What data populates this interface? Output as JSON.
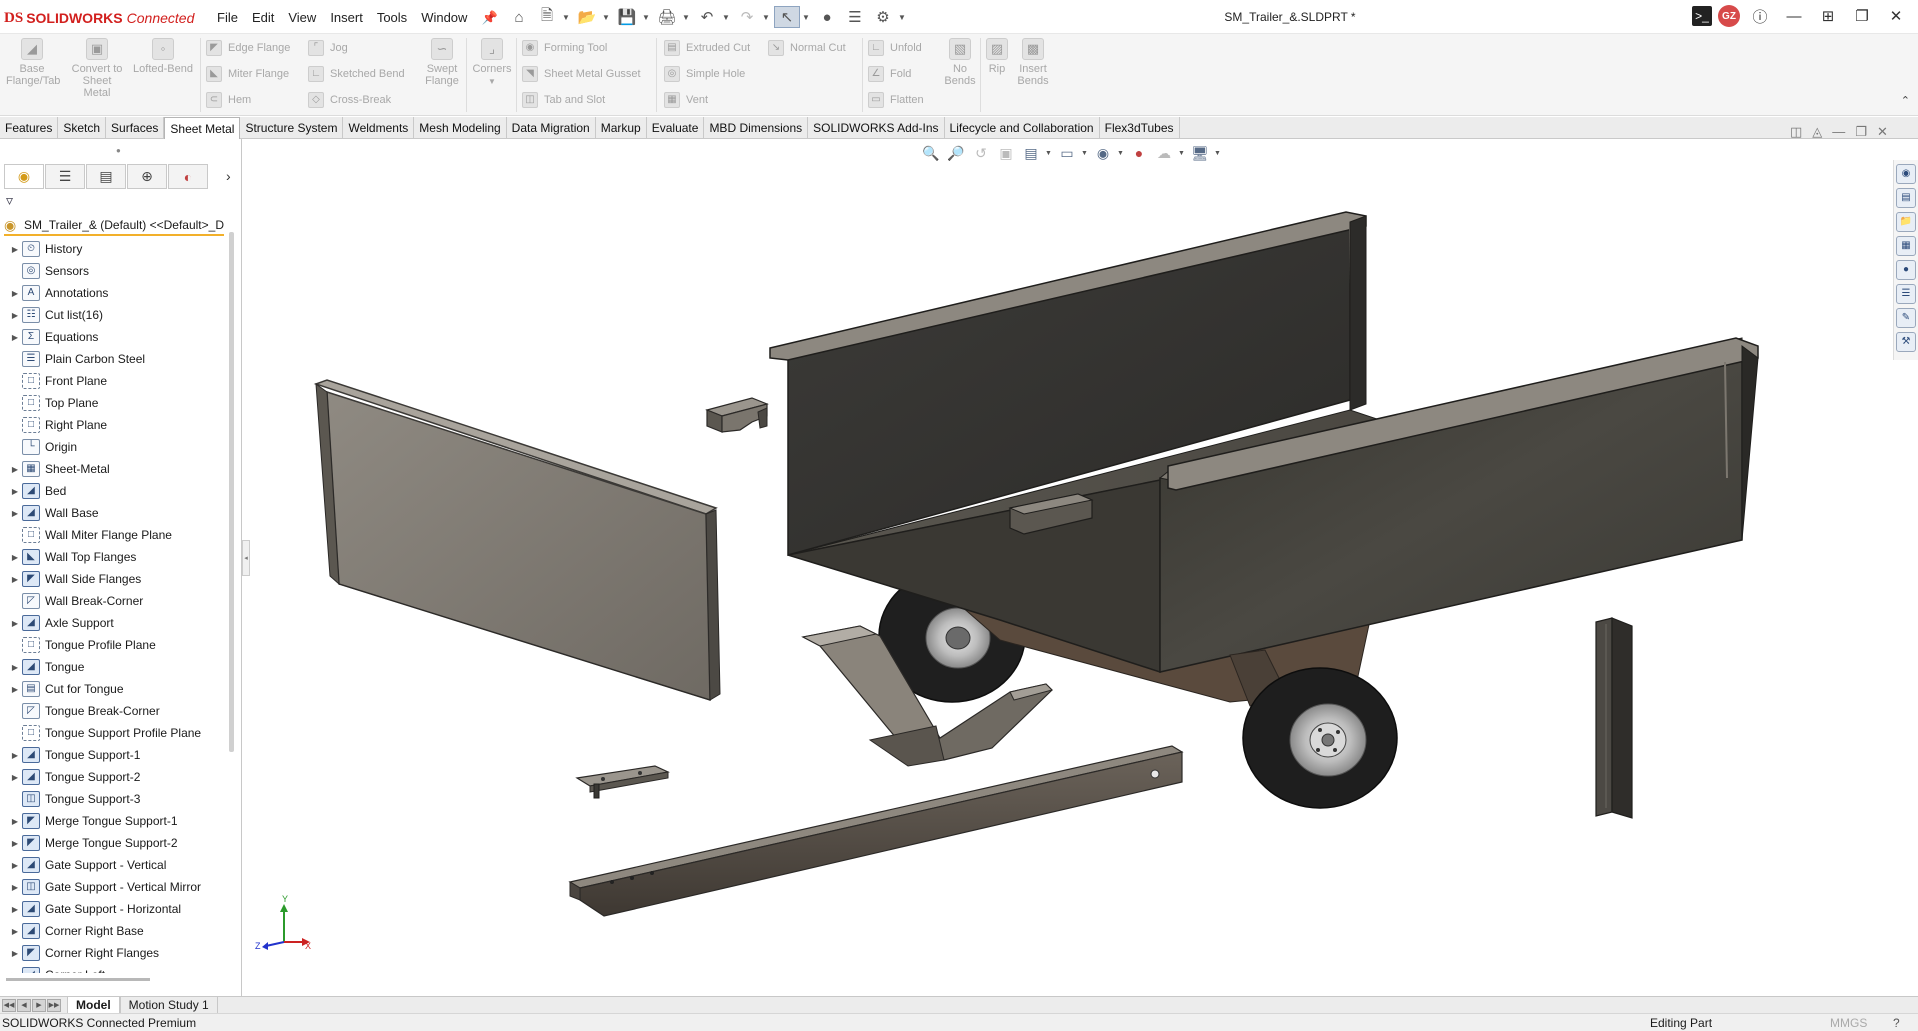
{
  "app": {
    "brand_mark": "DS",
    "brand_name": "SOLIDWORKS",
    "brand_suffix": "Connected"
  },
  "menu": [
    "File",
    "Edit",
    "View",
    "Insert",
    "Tools",
    "Window"
  ],
  "document_title": "SM_Trailer_&.SLDPRT *",
  "user_initials": "GZ",
  "ribbon": {
    "base_flange": "Base Flange/Tab",
    "convert": "Convert to Sheet Metal",
    "lofted_bend": "Lofted-Bend",
    "edge_flange": "Edge Flange",
    "jog": "Jog",
    "miter_flange": "Miter Flange",
    "sketched_bend": "Sketched Bend",
    "hem": "Hem",
    "cross_break": "Cross-Break",
    "swept_flange": "Swept Flange",
    "corners": "Corners",
    "forming_tool": "Forming Tool",
    "sheet_metal_gusset": "Sheet Metal Gusset",
    "tab_and_slot": "Tab and Slot",
    "extruded_cut": "Extruded Cut",
    "normal_cut": "Normal Cut",
    "simple_hole": "Simple Hole",
    "vent": "Vent",
    "unfold": "Unfold",
    "fold": "Fold",
    "flatten": "Flatten",
    "no_bends": "No Bends",
    "rip": "Rip",
    "insert_bends": "Insert Bends"
  },
  "tabs": [
    "Features",
    "Sketch",
    "Surfaces",
    "Sheet Metal",
    "Structure System",
    "Weldments",
    "Mesh Modeling",
    "Data Migration",
    "Markup",
    "Evaluate",
    "MBD Dimensions",
    "SOLIDWORKS Add-Ins",
    "Lifecycle and Collaboration",
    "Flex3dTubes"
  ],
  "active_tab": "Sheet Metal",
  "tree": {
    "root": "SM_Trailer_& (Default) <<Default>_D",
    "items": [
      {
        "label": "History",
        "icon": "history-icon",
        "exp": true
      },
      {
        "label": "Sensors",
        "icon": "sensors-icon",
        "exp": false
      },
      {
        "label": "Annotations",
        "icon": "annotations-icon",
        "exp": true
      },
      {
        "label": "Cut list(16)",
        "icon": "cut-list-icon",
        "exp": true
      },
      {
        "label": "Equations",
        "icon": "equations-icon",
        "exp": true
      },
      {
        "label": "Plain Carbon Steel",
        "icon": "material-icon",
        "exp": false
      },
      {
        "label": "Front Plane",
        "icon": "plane-icon",
        "exp": false
      },
      {
        "label": "Top Plane",
        "icon": "plane-icon",
        "exp": false
      },
      {
        "label": "Right Plane",
        "icon": "plane-icon",
        "exp": false
      },
      {
        "label": "Origin",
        "icon": "origin-icon",
        "exp": false
      },
      {
        "label": "Sheet-Metal",
        "icon": "sheet-metal-icon",
        "exp": true
      },
      {
        "label": "Bed",
        "icon": "base-flange-icon",
        "exp": true
      },
      {
        "label": "Wall Base",
        "icon": "base-flange-icon",
        "exp": true
      },
      {
        "label": "Wall Miter Flange Plane",
        "icon": "plane-icon",
        "exp": false
      },
      {
        "label": "Wall Top Flanges",
        "icon": "miter-flange-icon",
        "exp": true
      },
      {
        "label": "Wall Side Flanges",
        "icon": "edge-flange-icon",
        "exp": true
      },
      {
        "label": "Wall Break-Corner",
        "icon": "break-corner-icon",
        "exp": false
      },
      {
        "label": "Axle Support",
        "icon": "base-flange-icon",
        "exp": true
      },
      {
        "label": "Tongue Profile Plane",
        "icon": "plane-icon",
        "exp": false
      },
      {
        "label": "Tongue",
        "icon": "base-flange-icon",
        "exp": true
      },
      {
        "label": "Cut for Tongue",
        "icon": "cut-icon",
        "exp": true
      },
      {
        "label": "Tongue Break-Corner",
        "icon": "break-corner-icon",
        "exp": false
      },
      {
        "label": "Tongue Support Profile Plane",
        "icon": "plane-icon",
        "exp": false
      },
      {
        "label": "Tongue Support-1",
        "icon": "base-flange-icon",
        "exp": true
      },
      {
        "label": "Tongue Support-2",
        "icon": "base-flange-icon",
        "exp": true
      },
      {
        "label": "Tongue Support-3",
        "icon": "mirror-icon",
        "exp": false
      },
      {
        "label": "Merge Tongue Support-1",
        "icon": "edge-flange-icon",
        "exp": true
      },
      {
        "label": "Merge Tongue Support-2",
        "icon": "edge-flange-icon",
        "exp": true
      },
      {
        "label": "Gate Support - Vertical",
        "icon": "base-flange-icon",
        "exp": true
      },
      {
        "label": "Gate Support - Vertical Mirror",
        "icon": "mirror-icon",
        "exp": true
      },
      {
        "label": "Gate Support - Horizontal",
        "icon": "base-flange-icon",
        "exp": true
      },
      {
        "label": "Corner Right Base",
        "icon": "base-flange-icon",
        "exp": true
      },
      {
        "label": "Corner Right Flanges",
        "icon": "edge-flange-icon",
        "exp": true
      },
      {
        "label": "Corner Left ...",
        "icon": "base-flange-icon",
        "exp": true
      }
    ]
  },
  "triad": {
    "x": "X",
    "y": "Y",
    "z": "Z"
  },
  "bottom_tabs": [
    "Model",
    "Motion Study 1"
  ],
  "status": {
    "product": "SOLIDWORKS Connected Premium",
    "mode": "Editing Part",
    "units": "MMGS",
    "help": "?"
  },
  "colors": {
    "accent": "#d2201e",
    "selection": "#f2b02a",
    "sheet_dark": "#3a3936",
    "sheet_light": "#8a857d"
  }
}
